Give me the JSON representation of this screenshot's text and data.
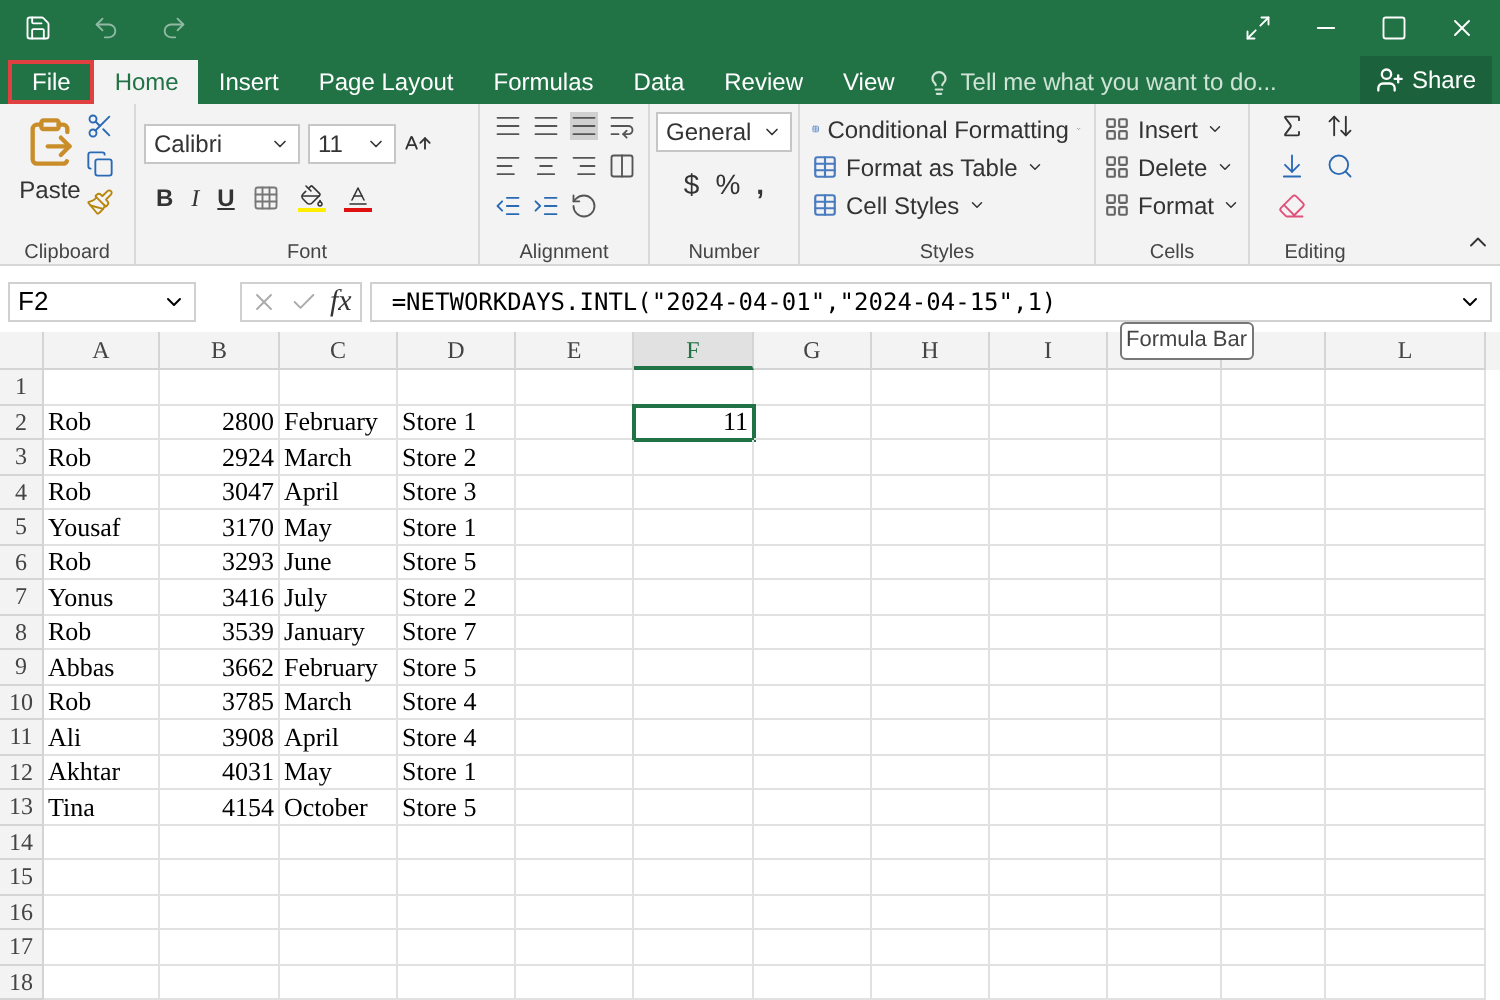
{
  "tabs": [
    {
      "label": "File",
      "selected": false,
      "highlighted": true
    },
    {
      "label": "Home",
      "selected": true,
      "highlighted": false
    },
    {
      "label": "Insert",
      "selected": false,
      "highlighted": false
    },
    {
      "label": "Page Layout",
      "selected": false,
      "highlighted": false
    },
    {
      "label": "Formulas",
      "selected": false,
      "highlighted": false
    },
    {
      "label": "Data",
      "selected": false,
      "highlighted": false
    },
    {
      "label": "Review",
      "selected": false,
      "highlighted": false
    },
    {
      "label": "View",
      "selected": false,
      "highlighted": false
    }
  ],
  "tell_me": {
    "placeholder": "Tell me what you want to do..."
  },
  "share": "Share",
  "ribbon": {
    "clipboard": {
      "label": "Clipboard",
      "paste": "Paste"
    },
    "font": {
      "label": "Font",
      "name": "Calibri",
      "size": "11",
      "bold": "B",
      "italic": "I",
      "underline": "U"
    },
    "alignment": {
      "label": "Alignment"
    },
    "number": {
      "label": "Number",
      "format": "General",
      "currency": "$",
      "percent": "%",
      "comma": ","
    },
    "styles": {
      "label": "Styles",
      "items": [
        "Conditional Formatting",
        "Format as Table",
        "Cell Styles"
      ]
    },
    "cells": {
      "label": "Cells",
      "items": [
        "Insert",
        "Delete",
        "Format"
      ]
    },
    "editing": {
      "label": "Editing"
    }
  },
  "formula_bar": {
    "name_box": "F2",
    "fx": "fx",
    "formula": "=NETWORKDAYS.INTL(\"2024-04-01\",\"2024-04-15\",1)",
    "tooltip": "Formula Bar"
  },
  "columns": [
    {
      "label": "A",
      "selected": false
    },
    {
      "label": "B",
      "selected": false
    },
    {
      "label": "C",
      "selected": false
    },
    {
      "label": "D",
      "selected": false
    },
    {
      "label": "E",
      "selected": false
    },
    {
      "label": "F",
      "selected": true
    },
    {
      "label": "G",
      "selected": false
    },
    {
      "label": "H",
      "selected": false
    },
    {
      "label": "I",
      "selected": false
    }
  ],
  "columns_right": [
    {
      "label": "L",
      "selected": false
    }
  ],
  "rows": [
    {
      "number": "1"
    },
    {
      "number": "2",
      "cells": [
        "Rob",
        "2800",
        "February",
        "Store 1",
        null,
        {
          "value": "11",
          "selected": true
        }
      ]
    },
    {
      "number": "3",
      "cells": [
        "Rob",
        "2924",
        "March",
        "Store 2"
      ]
    },
    {
      "number": "4",
      "cells": [
        "Rob",
        "3047",
        "April",
        "Store 3"
      ]
    },
    {
      "number": "5",
      "cells": [
        "Yousaf",
        "3170",
        "May",
        "Store 1"
      ]
    },
    {
      "number": "6",
      "cells": [
        "Rob",
        "3293",
        "June",
        "Store 5"
      ]
    },
    {
      "number": "7",
      "cells": [
        "Yonus",
        "3416",
        "July",
        "Store 2"
      ]
    },
    {
      "number": "8",
      "cells": [
        "Rob",
        "3539",
        "January",
        "Store 7"
      ]
    },
    {
      "number": "9",
      "cells": [
        "Abbas",
        "3662",
        "February",
        "Store 5"
      ]
    },
    {
      "number": "10",
      "cells": [
        "Rob",
        "3785",
        "March",
        "Store 4"
      ]
    },
    {
      "number": "11",
      "cells": [
        "Ali",
        "3908",
        "April",
        "Store 4"
      ]
    },
    {
      "number": "12",
      "cells": [
        "Akhtar",
        "4031",
        "May",
        "Store 1"
      ]
    },
    {
      "number": "13",
      "cells": [
        "Tina",
        "4154",
        "October",
        "Store 5"
      ]
    },
    {
      "number": "14"
    },
    {
      "number": "15"
    },
    {
      "number": "16"
    },
    {
      "number": "17"
    },
    {
      "number": "18"
    }
  ]
}
